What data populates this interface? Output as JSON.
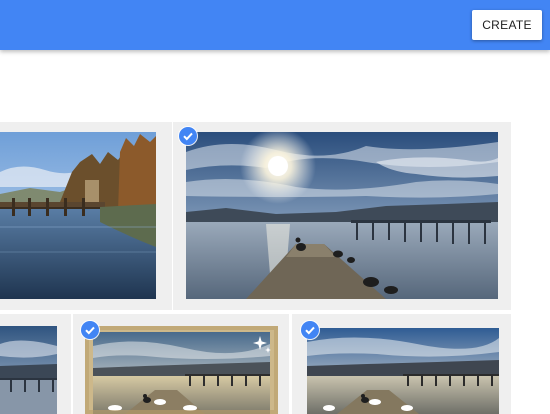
{
  "toolbar": {
    "create_label": "CREATE"
  },
  "photos": [
    {
      "name": "lake-trees-photo",
      "selected": false
    },
    {
      "name": "sunlit-jetty-photo",
      "selected": true
    },
    {
      "name": "lake-partial-photo",
      "selected": true
    },
    {
      "name": "swans-jetty-framed-photo",
      "selected": true,
      "badge": "sparkle-icon"
    },
    {
      "name": "swans-jetty-photo",
      "selected": true
    }
  ],
  "colors": {
    "app_bar": "#4285f4",
    "check_badge": "#4285f4",
    "tile_background": "#efefef"
  }
}
